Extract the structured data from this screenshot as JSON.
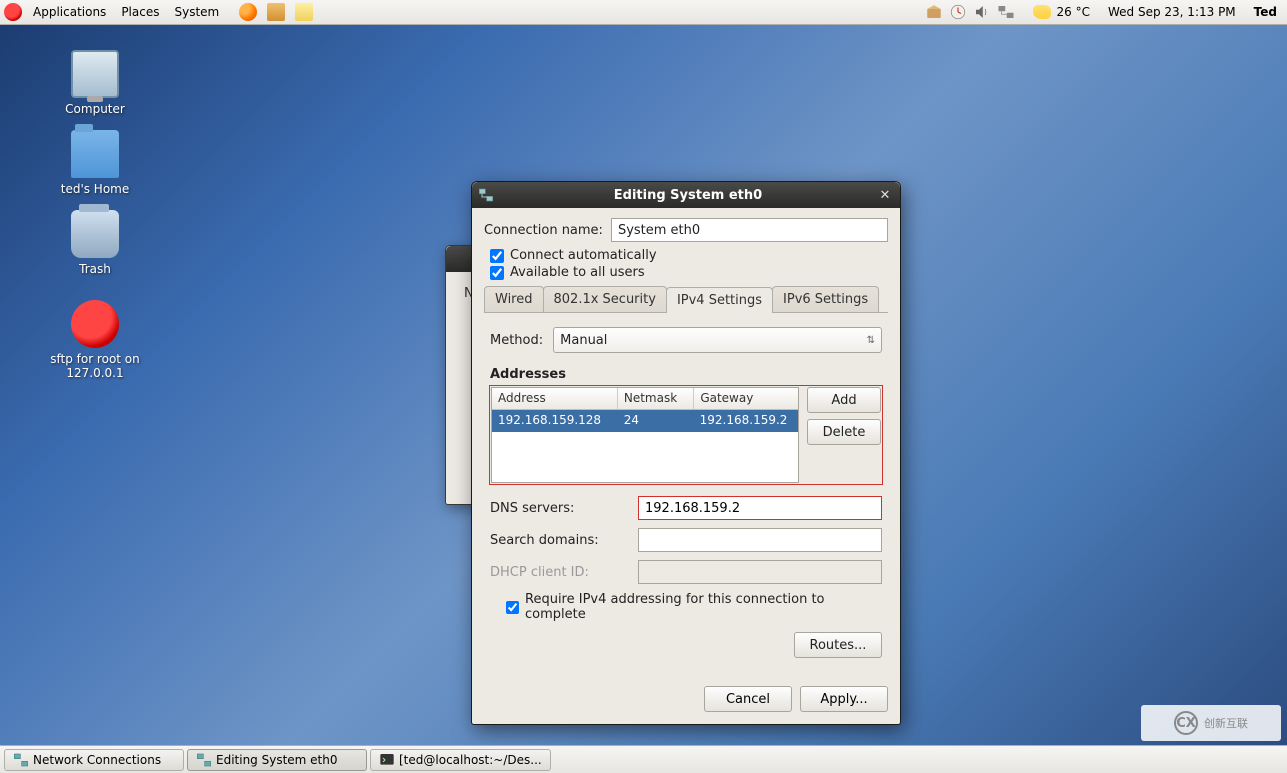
{
  "top_panel": {
    "applications": "Applications",
    "places": "Places",
    "system": "System",
    "temp": "26 °C",
    "date_time": "Wed Sep 23,  1:13 PM",
    "user": "Ted"
  },
  "desktop_icons": {
    "computer": "Computer",
    "home": "ted's Home",
    "trash": "Trash",
    "sftp": "sftp for root on 127.0.0.1"
  },
  "bg_window": {
    "tab_visible": "N"
  },
  "dialog": {
    "title": "Editing System eth0",
    "conn_name_label": "Connection name:",
    "conn_name_value": "System eth0",
    "connect_auto": "Connect automatically",
    "avail_all": "Available to all users",
    "tabs": {
      "wired": "Wired",
      "sec": "802.1x Security",
      "ipv4": "IPv4 Settings",
      "ipv6": "IPv6 Settings"
    },
    "method_label": "Method:",
    "method_value": "Manual",
    "addresses_label": "Addresses",
    "addr_headers": {
      "address": "Address",
      "netmask": "Netmask",
      "gateway": "Gateway"
    },
    "addr_row": {
      "address": "192.168.159.128",
      "netmask": "24",
      "gateway": "192.168.159.2"
    },
    "add_btn": "Add",
    "delete_btn": "Delete",
    "dns_label": "DNS servers:",
    "dns_value": "192.168.159.2",
    "search_label": "Search domains:",
    "search_value": "",
    "dhcp_label": "DHCP client ID:",
    "dhcp_value": "",
    "require_ipv4": "Require IPv4 addressing for this connection to complete",
    "routes_btn": "Routes...",
    "cancel_btn": "Cancel",
    "apply_btn": "Apply..."
  },
  "taskbar": {
    "task1": "Network Connections",
    "task2": "Editing System eth0",
    "task3": "[ted@localhost:~/Des..."
  },
  "watermark": "创新互联"
}
